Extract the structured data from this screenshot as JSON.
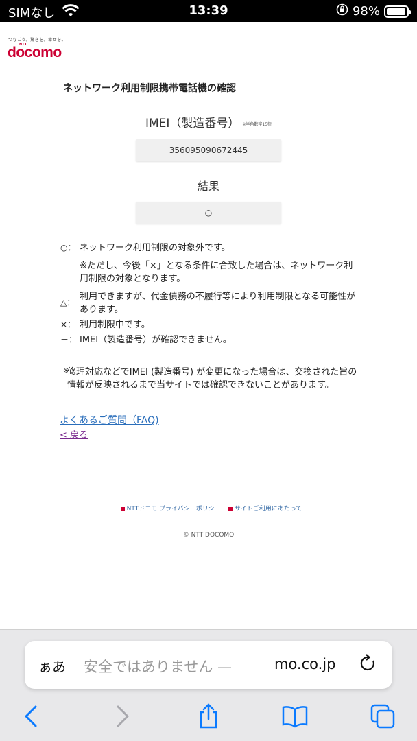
{
  "status": {
    "carrier": "SIMなし",
    "time": "13:39",
    "battery_pct": "98%",
    "battery_level": 0.98
  },
  "header": {
    "tagline": "つなごう。驚きを。幸せを。",
    "ntt": "NTT",
    "logo": "docomo"
  },
  "page": {
    "title": "ネットワーク利用制限携帯電話機の確認",
    "imei_label": "IMEI（製造番号）",
    "imei_note": "※半角数字15桁",
    "imei_value": "356095090672445",
    "result_label": "結果",
    "result_value": "○"
  },
  "legend": [
    {
      "symbol": "○：",
      "text": "ネットワーク利用制限の対象外です。"
    },
    {
      "symbol": "",
      "text": "※ただし、今後「×」となる条件に合致した場合は、ネットワーク利用制限の対象となります。"
    },
    {
      "symbol": "△：",
      "text": "利用できますが、代金債務の不履行等により利用制限となる可能性があります。"
    },
    {
      "symbol": "×：",
      "text": "利用制限中です。"
    },
    {
      "symbol": "－：",
      "text": "IMEI（製造番号）が確認できません。"
    }
  ],
  "note": {
    "star": "※",
    "text": "修理対応などでIMEI (製造番号) が変更になった場合は、交換された旨の情報が反映されるまで当サイトでは確認できないことがあります。"
  },
  "links": {
    "faq": "よくあるご質問（FAQ)",
    "back": "< 戻る"
  },
  "footer": {
    "privacy": "NTTドコモ プライバシーポリシー",
    "terms": "サイトご利用にあたって",
    "copyright": "© NTT DOCOMO"
  },
  "browser": {
    "aa": "ぁあ",
    "url_insecure": "安全ではありません — ",
    "url": "mo.co.jp"
  },
  "colors": {
    "brand": "#cc0033",
    "link": "#2a6ebb",
    "ios_blue": "#0a7aff"
  }
}
